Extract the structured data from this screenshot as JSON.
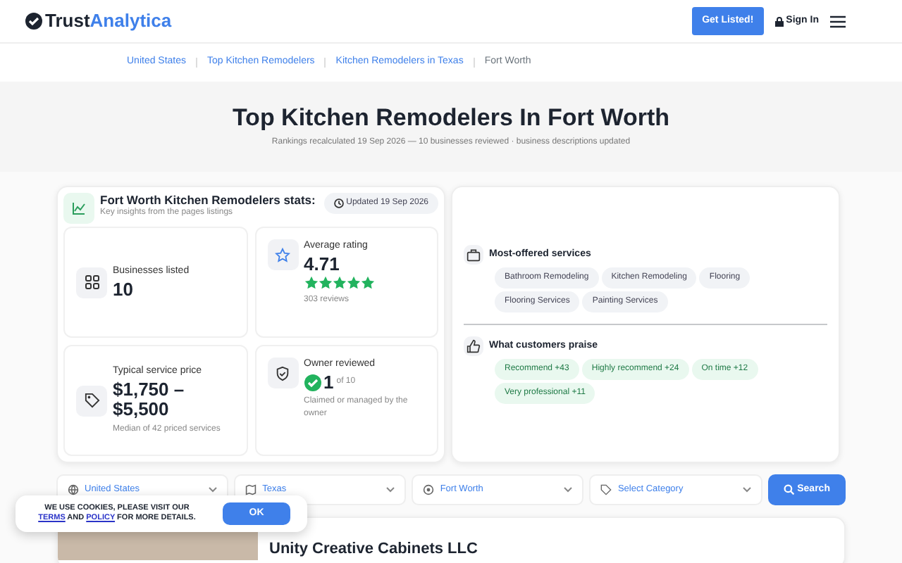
{
  "brand": {
    "part_1": "Trust",
    "part_2": "Analytica"
  },
  "nav": {
    "cta": "Get Listed!",
    "sign_in": "Sign In"
  },
  "breadcrumbs": [
    {
      "label": "United States",
      "link": true
    },
    {
      "label": "Top Kitchen Remodelers",
      "link": true
    },
    {
      "label": "Kitchen Remodelers in Texas",
      "link": true
    },
    {
      "label": "Fort Worth",
      "link": false
    }
  ],
  "hero": {
    "title": "Top Kitchen Remodelers In Fort Worth",
    "subtitle": "Rankings recalculated 19 Sep 2026 — 10 businesses reviewed · business descriptions updated"
  },
  "stats": {
    "title": "Fort Worth Kitchen Remodelers stats:",
    "subtitle": "Key insights from the pages listings",
    "updated": "Updated 19 Sep 2026",
    "tiles": [
      {
        "kind": "count",
        "label": "Businesses listed",
        "value": "10"
      },
      {
        "kind": "rating",
        "label": "Average rating",
        "value": "4.71",
        "stars": 5,
        "note": "303 reviews"
      },
      {
        "kind": "price",
        "label": "Typical service price",
        "value": "$1,750 – $5,500",
        "note": "Median of 42 priced services"
      },
      {
        "kind": "owner",
        "label": "Owner reviewed",
        "value": "1",
        "suffix": "of 10",
        "note": "Claimed or managed by the owner"
      }
    ]
  },
  "services": {
    "title": "Most-offered services",
    "tags": [
      "Bathroom Remodeling",
      "Kitchen Remodeling",
      "Flooring",
      "Flooring Services",
      "Painting Services"
    ]
  },
  "praise": {
    "title": "What customers praise",
    "tags": [
      "Recommend +43",
      "Highly recommend +24",
      "On time +12",
      "Very professional +11"
    ]
  },
  "filters": [
    {
      "kind": "globe",
      "value": "United States"
    },
    {
      "kind": "map",
      "value": "Texas"
    },
    {
      "kind": "pin",
      "value": "Fort Worth"
    },
    {
      "kind": "tag",
      "value": "Select Category"
    }
  ],
  "search_button": "Search",
  "listing": {
    "name": "Unity Creative Cabinets LLC"
  },
  "cookie": {
    "terms": "TERMS",
    "policy": "POLICY",
    "before": "WE USE COOKIES, PLEASE VISIT OUR",
    "middle": "AND",
    "after": "FOR MORE DETAILS.",
    "button": "OK"
  }
}
